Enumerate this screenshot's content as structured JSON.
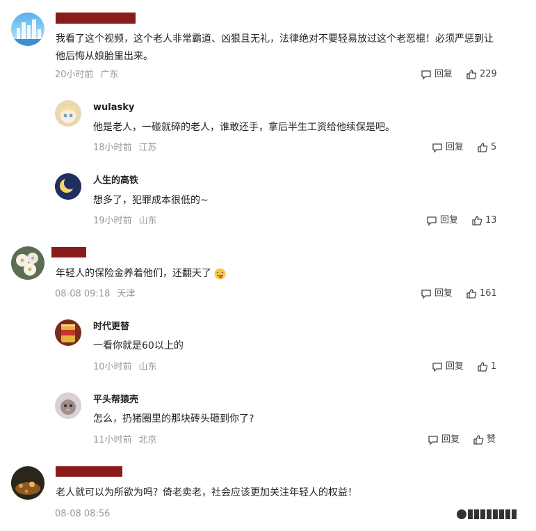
{
  "comments": [
    {
      "name": "",
      "text_lines": [
        "我看了这个视频，这个老人非常霸道、凶狠且无礼，法律绝对不要轻易放过这个老恶棍！必须严惩到让",
        "他后悔从娘胎里出来。"
      ],
      "time": "20小时前",
      "location": "广东",
      "reply_label": "回复",
      "likes": "229"
    },
    {
      "name": "wulasky",
      "text_lines": [
        "他是老人，一碰就碎的老人，谁敢还手，拿后半生工资给他续保是吧。"
      ],
      "time": "18小时前",
      "location": "江苏",
      "reply_label": "回复",
      "likes": "5"
    },
    {
      "name": "人生的高铁",
      "text_lines": [
        "想多了，犯罪成本很低的~"
      ],
      "time": "19小时前",
      "location": "山东",
      "reply_label": "回复",
      "likes": "13"
    },
    {
      "name": "",
      "text_lines": [
        "年轻人的保险金养着他们，还翻天了"
      ],
      "time": "08-08 09:18",
      "location": "天津",
      "reply_label": "回复",
      "likes": "161"
    },
    {
      "name": "时代更替",
      "text_lines": [
        "一看你就是60以上的"
      ],
      "time": "10小时前",
      "location": "山东",
      "reply_label": "回复",
      "likes": "1"
    },
    {
      "name": "平头帮猿壳",
      "text_lines": [
        "怎么，扔猪圈里的那块砖头砸到你了?"
      ],
      "time": "11小时前",
      "location": "北京",
      "reply_label": "回复",
      "likes": "赞"
    },
    {
      "name": "",
      "text_lines": [
        "老人就可以为所欲为吗？倚老卖老，社会应该更加关注年轻人的权益！"
      ],
      "time": "08-08 08:56",
      "location": "",
      "reply_label": "",
      "likes": ""
    }
  ],
  "icons": {
    "reply": "comment-bubble-icon",
    "like": "thumbs-up-icon",
    "emoji": "tongue-out-emoji-icon"
  },
  "colors": {
    "redact": "#8b1a1a",
    "meta": "#999999",
    "text": "#222222"
  }
}
